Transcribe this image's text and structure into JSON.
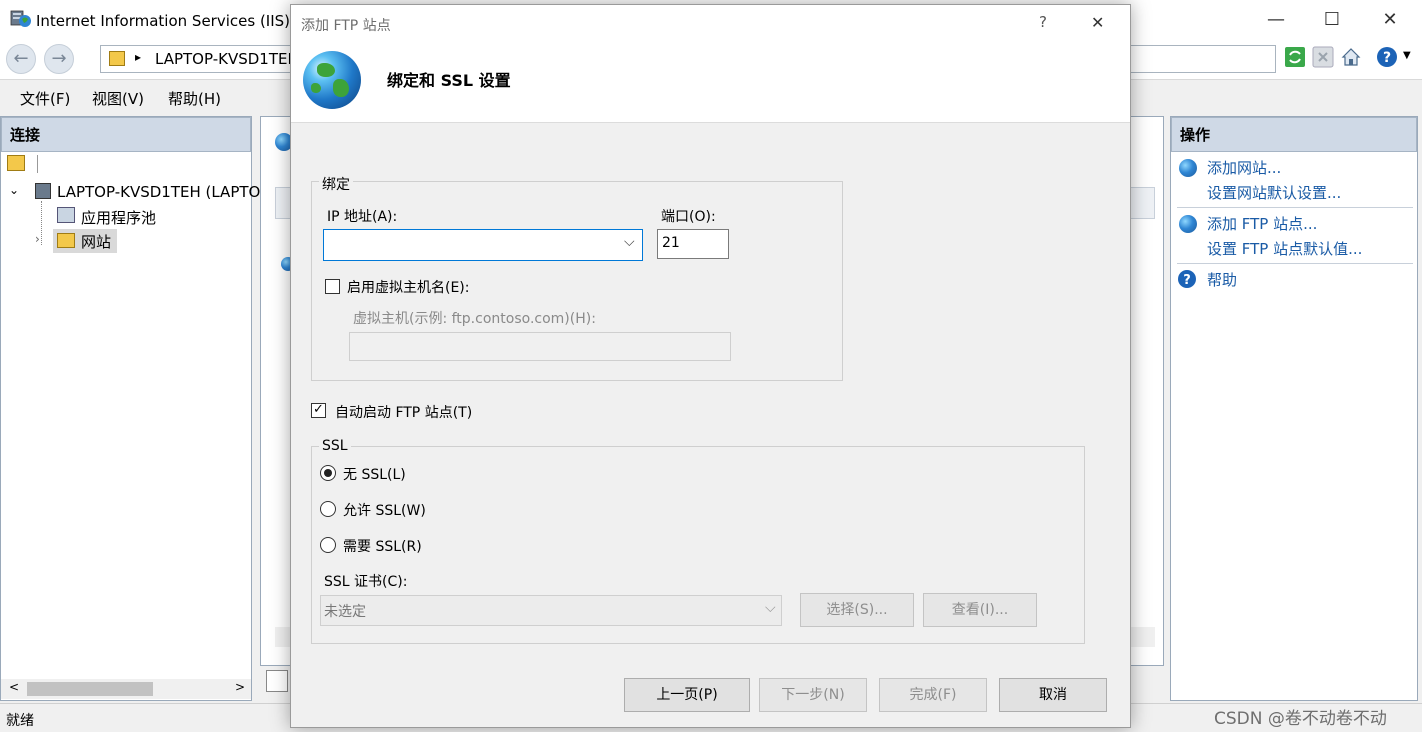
{
  "window": {
    "title": "Internet Information Services (IIS)管",
    "minimize": "—",
    "maximize": "☐",
    "close": "✕"
  },
  "address_bar": {
    "path": "LAPTOP-KVSD1TEH",
    "separator": "▸"
  },
  "menu": {
    "items": [
      "文件(F)",
      "视图(V)",
      "帮助(H)"
    ]
  },
  "connections": {
    "header": "连接",
    "tree": {
      "server": "LAPTOP-KVSD1TEH (LAPTO",
      "app_pools": "应用程序池",
      "sites": "网站"
    }
  },
  "actions": {
    "header": "操作",
    "links": [
      "添加网站...",
      "设置网站默认设置...",
      "添加 FTP 站点...",
      "设置 FTP 站点默认值...",
      "帮助"
    ]
  },
  "statusbar": {
    "text": "就绪"
  },
  "dialog": {
    "title": "添加 FTP 站点",
    "help": "?",
    "close": "✕",
    "heading": "绑定和 SSL 设置",
    "binding": {
      "group_label": "绑定",
      "ip_label": "IP 地址(A):",
      "ip_value": "",
      "port_label": "端口(O):",
      "port_value": "21",
      "enable_virtual_host_label": "启用虚拟主机名(E):",
      "enable_virtual_host_checked": false,
      "virtual_host_label": "虚拟主机(示例: ftp.contoso.com)(H):",
      "virtual_host_value": ""
    },
    "auto_start": {
      "label": "自动启动 FTP 站点(T)",
      "checked": true
    },
    "ssl": {
      "group_label": "SSL",
      "options": [
        "无 SSL(L)",
        "允许 SSL(W)",
        "需要 SSL(R)"
      ],
      "selected": "无 SSL(L)",
      "cert_label": "SSL 证书(C):",
      "cert_value": "未选定",
      "select_button": "选择(S)...",
      "view_button": "查看(I)..."
    },
    "buttons": {
      "prev": "上一页(P)",
      "next": "下一步(N)",
      "finish": "完成(F)",
      "cancel": "取消"
    }
  },
  "watermark": "CSDN @卷不动卷不动"
}
